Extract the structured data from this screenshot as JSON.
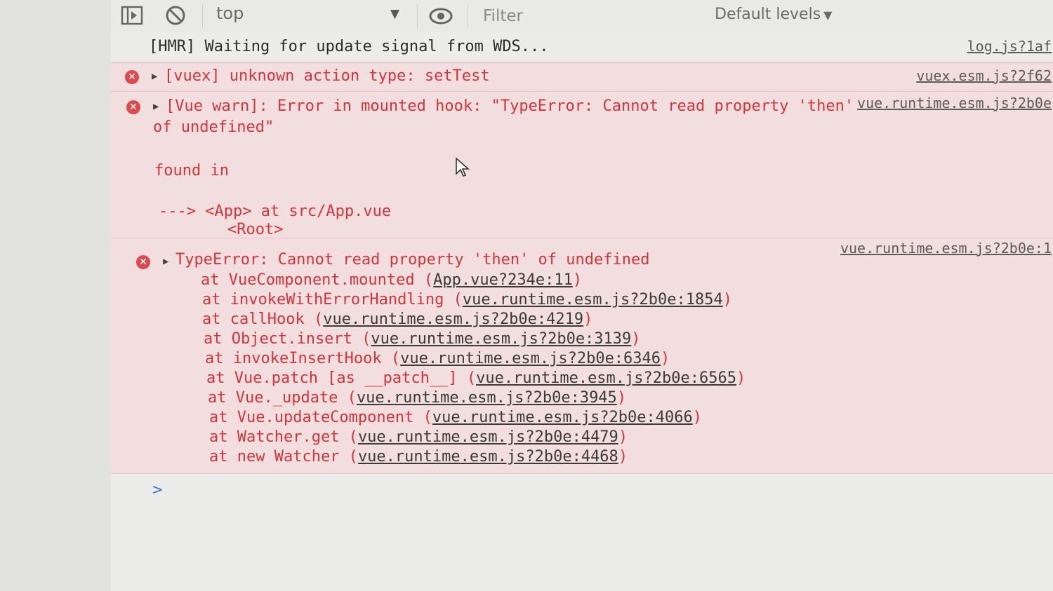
{
  "toolbar": {
    "context": "top",
    "filter_placeholder": "Filter",
    "levels_label": "Default levels"
  },
  "messages": {
    "hmr": {
      "text": "[HMR] Waiting for update signal from WDS...",
      "source": "log.js?1af"
    },
    "vuex": {
      "text": "[vuex] unknown action type: setTest",
      "source": "vuex.esm.js?2f62"
    },
    "vue_warn": {
      "lines": [
        "[Vue warn]: Error in mounted hook: \"TypeError: Cannot read property 'then'",
        "of undefined\"",
        "found in",
        "---> <App> at src/App.vue",
        "<Root>"
      ],
      "source": "vue.runtime.esm.js?2b0e"
    },
    "type_error": {
      "header": "TypeError: Cannot read property 'then' of undefined",
      "source": "vue.runtime.esm.js?2b0e:1",
      "stack": [
        {
          "at": "at VueComponent.mounted",
          "loc": "App.vue?234e:11"
        },
        {
          "at": "at invokeWithErrorHandling",
          "loc": "vue.runtime.esm.js?2b0e:1854"
        },
        {
          "at": "at callHook",
          "loc": "vue.runtime.esm.js?2b0e:4219"
        },
        {
          "at": "at Object.insert",
          "loc": "vue.runtime.esm.js?2b0e:3139"
        },
        {
          "at": "at invokeInsertHook",
          "loc": "vue.runtime.esm.js?2b0e:6346"
        },
        {
          "at": "at Vue.patch [as __patch__]",
          "loc": "vue.runtime.esm.js?2b0e:6565"
        },
        {
          "at": "at Vue._update",
          "loc": "vue.runtime.esm.js?2b0e:3945"
        },
        {
          "at": "at Vue.updateComponent",
          "loc": "vue.runtime.esm.js?2b0e:4066"
        },
        {
          "at": "at Watcher.get",
          "loc": "vue.runtime.esm.js?2b0e:4479"
        },
        {
          "at": "at new Watcher",
          "loc": "vue.runtime.esm.js?2b0e:4468"
        }
      ]
    }
  },
  "prompt_symbol": ">",
  "icons": {
    "sidebar_toggle": "sidebar-toggle-icon",
    "clear": "clear-console-icon",
    "eye": "eye-icon",
    "error": "error-icon",
    "expand": "expand-triangle-icon"
  },
  "colors": {
    "error_text": "#d1343a",
    "error_bg": "#f2dede",
    "prompt": "#2f6fd6"
  }
}
